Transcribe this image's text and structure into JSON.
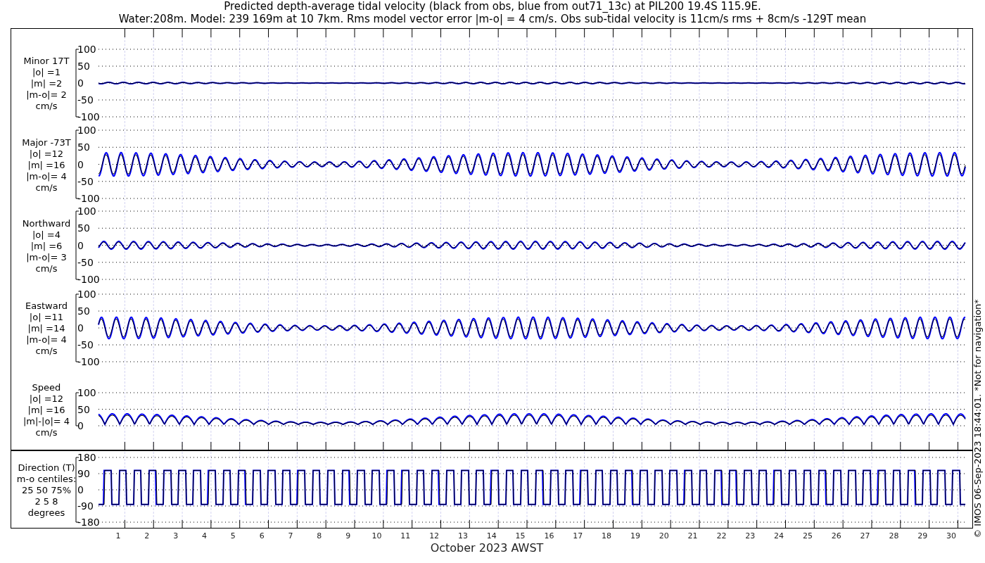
{
  "figure": {
    "title_lines": [
      "Predicted depth-average tidal velocity (black from obs, blue from out71_13c) at PIL200 19.4S 115.9E.",
      "Water:208m. Model: 239 169m at 10 7km. Rms model vector error |m-o| = 4 cm/s. Obs sub-tidal velocity is 11cm/s rms + 8cm/s -129T mean"
    ],
    "panels": [
      {
        "kind": "velocity",
        "label_lines": [
          "Minor 17T",
          "|o| =1",
          "|m| =2",
          "|m-o|= 2",
          "cm/s"
        ],
        "y_tick_labels": [
          "100",
          "50",
          "0",
          "-50",
          "-100"
        ]
      },
      {
        "kind": "velocity",
        "label_lines": [
          "Major -73T",
          "|o| =12",
          "|m| =16",
          "|m-o|= 4",
          "cm/s"
        ],
        "y_tick_labels": [
          "100",
          "50",
          "0",
          "-50",
          "-100"
        ]
      },
      {
        "kind": "velocity",
        "label_lines": [
          "Northward",
          "|o| =4",
          "|m| =6",
          "|m-o|= 3",
          "cm/s"
        ],
        "y_tick_labels": [
          "100",
          "50",
          "0",
          "-50",
          "-100"
        ]
      },
      {
        "kind": "velocity",
        "label_lines": [
          "Eastward",
          "|o| =11",
          "|m| =14",
          "|m-o|= 4",
          "cm/s"
        ],
        "y_tick_labels": [
          "100",
          "50",
          "0",
          "-50",
          "-100"
        ]
      },
      {
        "kind": "speed",
        "label_lines": [
          "Speed",
          "|o| =12",
          "|m| =16",
          "|m|-|o|= 4",
          "cm/s"
        ],
        "y_tick_labels": [
          "100",
          "50",
          "0"
        ]
      },
      {
        "kind": "direction",
        "label_lines": [
          "Direction (T)",
          "m-o centiles:",
          "25  50  75%",
          "2  5  8",
          "degrees"
        ],
        "y_tick_labels": [
          "180",
          "90",
          "0",
          "-90",
          "-180"
        ]
      }
    ],
    "x_tick_labels": [
      "1",
      "2",
      "3",
      "4",
      "5",
      "6",
      "7",
      "8",
      "9",
      "10",
      "11",
      "12",
      "13",
      "14",
      "15",
      "16",
      "17",
      "18",
      "19",
      "20",
      "21",
      "22",
      "23",
      "24",
      "25",
      "26",
      "27",
      "28",
      "29",
      "30"
    ],
    "xlabel": "October 2023 AWST",
    "footnote": "© IMOS 06-Sep-2023 18:44:01. *Not for navigation*"
  }
}
